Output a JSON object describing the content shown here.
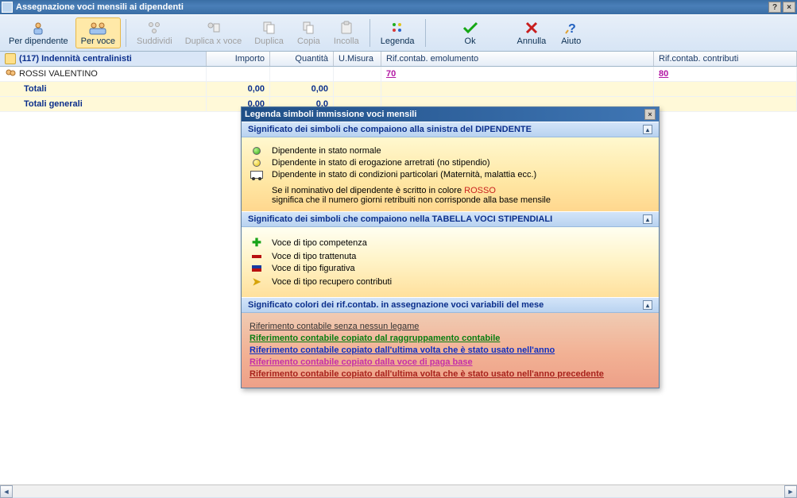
{
  "window": {
    "title": "Assegnazione voci mensili ai dipendenti"
  },
  "toolbar": {
    "per_dipendente": "Per dipendente",
    "per_voce": "Per voce",
    "suddividi": "Suddividi",
    "duplica_x_voce": "Duplica x voce",
    "duplica": "Duplica",
    "copia": "Copia",
    "incolla": "Incolla",
    "legenda": "Legenda",
    "ok": "Ok",
    "annulla": "Annulla",
    "aiuto": "Aiuto"
  },
  "grid": {
    "headers": {
      "voce": "(117) Indennità centralinisti",
      "importo": "Importo",
      "quantita": "Quantità",
      "umisura": "U.Misura",
      "rif_emol": "Rif.contab. emolumento",
      "rif_contr": "Rif.contab. contributi"
    },
    "rows": [
      {
        "name": "ROSSI VALENTINO",
        "importo": "",
        "quantita": "",
        "rif_emol": "70",
        "rif_contr": "80"
      }
    ],
    "totals": [
      {
        "label": "Totali",
        "importo": "0,00",
        "quantita": "0,00"
      },
      {
        "label": "Totali generali",
        "importo": "0,00",
        "quantita": "0,0"
      }
    ]
  },
  "legend": {
    "title": "Legenda simboli immissione voci mensili",
    "section1": {
      "header": "Significato dei simboli che compaiono alla sinistra del DIPENDENTE",
      "rows": [
        "Dipendente in stato normale",
        "Dipendente in stato di erogazione arretrati (no stipendio)",
        "Dipendente in stato di condizioni particolari (Maternità, malattia ecc.)"
      ],
      "note_pre": "Se il nominativo del dipendente è scritto in colore ",
      "note_red": "ROSSO",
      "note_post": "significa che il numero giorni retribuiti non corrisponde alla base mensile"
    },
    "section2": {
      "header": "Significato dei simboli che compaiono nella TABELLA VOCI STIPENDIALI",
      "rows": [
        "Voce di tipo competenza",
        "Voce di tipo trattenuta",
        "Voce di tipo figurativa",
        "Voce di tipo recupero contributi"
      ]
    },
    "section3": {
      "header": "Significato colori dei rif.contab. in assegnazione voci variabili del mese",
      "refs": [
        "Riferimento contabile senza nessun legame",
        "Riferimento contabile copiato dal raggruppamento contabile",
        "Riferimento contabile copiato dall'ultima volta che è stato usato nell'anno",
        "Riferimento contabile copiato dalla voce di paga base ",
        "Riferimento contabile copiato dall'ultima volta che è stato usato nell'anno precedente"
      ]
    }
  }
}
